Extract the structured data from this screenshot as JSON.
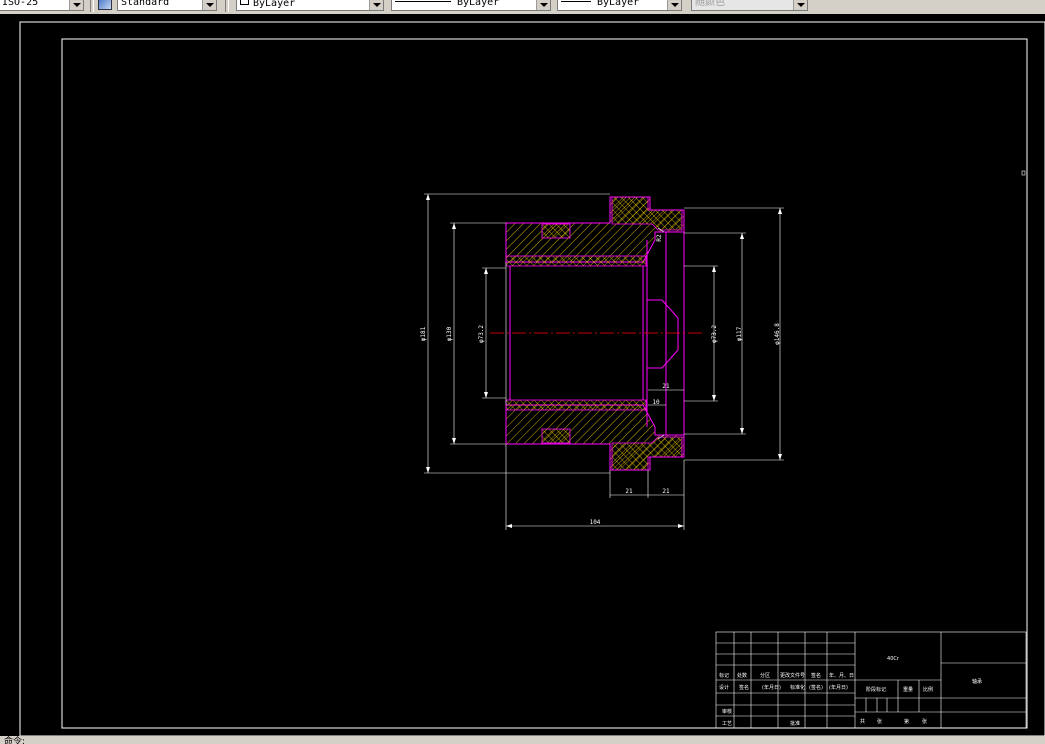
{
  "toolbar": {
    "dimstyle_value": "ISO-25",
    "textstyle_value": "Standard",
    "layer_value": "ByLayer",
    "linetype_value": "ByLayer",
    "lineweight_value": "ByLayer",
    "color_value": "随颜色"
  },
  "drawing": {
    "dims": {
      "d181": "φ181",
      "d130": "φ130",
      "d73a": "φ73.2",
      "d73b": "φ73.2",
      "d117": "φ117",
      "d1468": "φ146.8",
      "len21a": "21",
      "len21b": "21",
      "len21c": "21",
      "len10": "10",
      "len104": "104",
      "r1": "R2"
    },
    "title_block": {
      "part_name": "40Cr",
      "drawing_name": "轴承",
      "row1": [
        "标记",
        "处数",
        "分区",
        "更改文件号",
        "签名",
        "年、月、日"
      ],
      "row2": [
        "设计",
        "签名",
        "(年月日)",
        "标准化",
        "(签名)",
        "(年月日)"
      ],
      "row3": [
        "审核"
      ],
      "row4": [
        "工艺",
        "批准"
      ],
      "stage_labels": [
        "阶段标记",
        "重量",
        "比例"
      ],
      "sheet_labels": [
        "共",
        "张",
        "第",
        "张"
      ]
    }
  },
  "command_line": {
    "prompt": "命令:"
  },
  "colors": {
    "background": "#000000",
    "section_outline": "#ff00ff",
    "hatch": "#ffd700",
    "center_line": "#ff0000",
    "dimension": "#ffffff"
  }
}
